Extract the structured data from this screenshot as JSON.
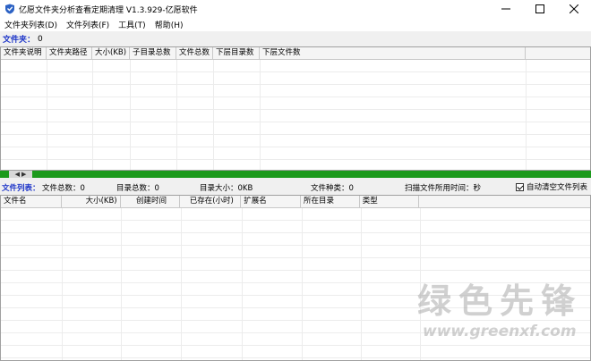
{
  "window": {
    "title": "亿愿文件夹分析查看定期清理 V1.3.929-亿愿软件",
    "minimize_glyph": "—",
    "maximize_glyph": "☐",
    "close_glyph": "✕"
  },
  "menu": {
    "items": [
      {
        "label": "文件夹列表(D)"
      },
      {
        "label": "文件列表(F)"
      },
      {
        "label": "工具(T)"
      },
      {
        "label": "帮助(H)"
      }
    ]
  },
  "folder_bar": {
    "label": "文件夹：",
    "value": "0"
  },
  "folder_table": {
    "columns": [
      "文件夹说明",
      "文件夹路径",
      "大小(KB)",
      "子目录总数",
      "文件总数",
      "下层目录数",
      "下层文件数"
    ]
  },
  "splitter": {
    "left_arrow": "◀",
    "right_arrow": "▶"
  },
  "stats": {
    "file_list_label": "文件列表：",
    "total_files": "文件总数：0",
    "total_dirs": "目录总数：0",
    "dir_size": "目录大小：0KB",
    "file_types": "文件种类：0",
    "scan_time": "扫描文件所用时间：秒",
    "auto_clear_label": "自动清空文件列表",
    "auto_clear_checked": true
  },
  "file_table": {
    "columns": [
      "文件名",
      "大小(KB)",
      "创建时间",
      "已存在(小时)",
      "扩展名",
      "所在目录",
      "类型"
    ]
  },
  "watermark": {
    "big": "绿色先锋",
    "small": "www.greenxf.com"
  },
  "colors": {
    "accent_blue": "#1c34c8",
    "splitter_green": "#1c9a1c"
  }
}
